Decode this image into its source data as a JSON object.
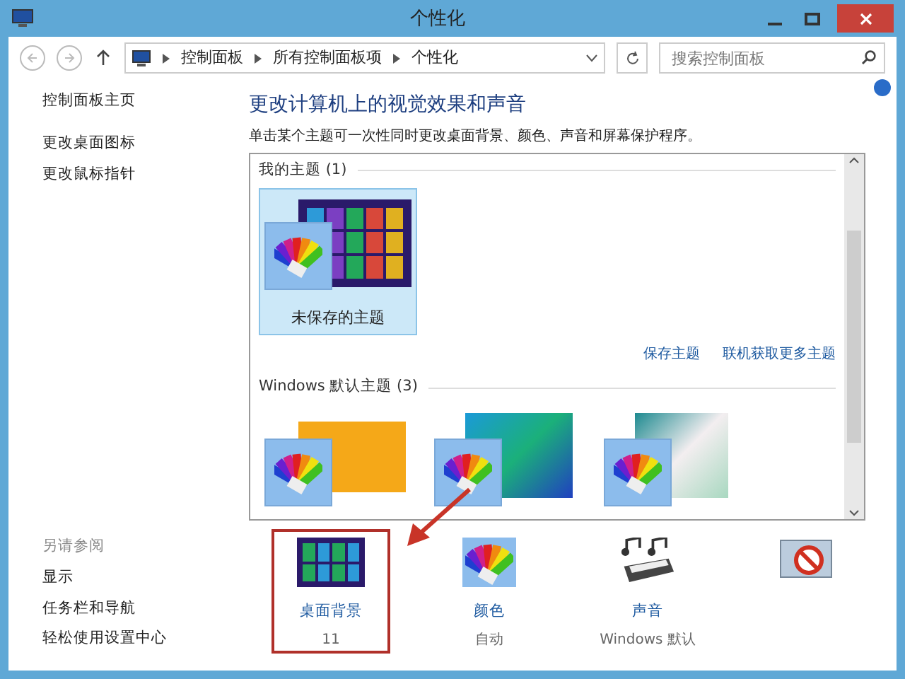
{
  "window": {
    "title": "个性化"
  },
  "address_bar": {
    "breadcrumbs": [
      "控制面板",
      "所有控制面板项",
      "个性化"
    ]
  },
  "search": {
    "placeholder": "搜索控制面板"
  },
  "sidebar": {
    "links": [
      "控制面板主页",
      "更改桌面图标",
      "更改鼠标指针"
    ],
    "see_also": {
      "title": "另请参阅",
      "links": [
        "显示",
        "任务栏和导航",
        "轻松使用设置中心"
      ]
    }
  },
  "heading": "更改计算机上的视觉效果和声音",
  "description": "单击某个主题可一次性同时更改桌面背景、颜色、声音和屏幕保护程序。",
  "theme_groups": [
    {
      "title": "我的主题 (1)",
      "themes": [
        {
          "kind": "start",
          "name": "未保存的主题",
          "selected": true
        }
      ],
      "links": [
        "保存主题",
        "联机获取更多主题"
      ]
    },
    {
      "title": "Windows 默认主题 (3)",
      "themes": [
        {
          "kind": "orange",
          "selected": false
        },
        {
          "kind": "lines",
          "selected": false
        },
        {
          "kind": "flowers",
          "selected": false
        }
      ]
    }
  ],
  "settings": [
    {
      "kind": "background",
      "label": "桌面背景",
      "value": "11",
      "highlighted": true
    },
    {
      "kind": "color",
      "label": "颜色",
      "value": "自动",
      "highlighted": false
    },
    {
      "kind": "sound",
      "label": "声音",
      "value": "Windows 默认",
      "highlighted": false
    },
    {
      "kind": "screensaver",
      "highlighted": false
    }
  ]
}
